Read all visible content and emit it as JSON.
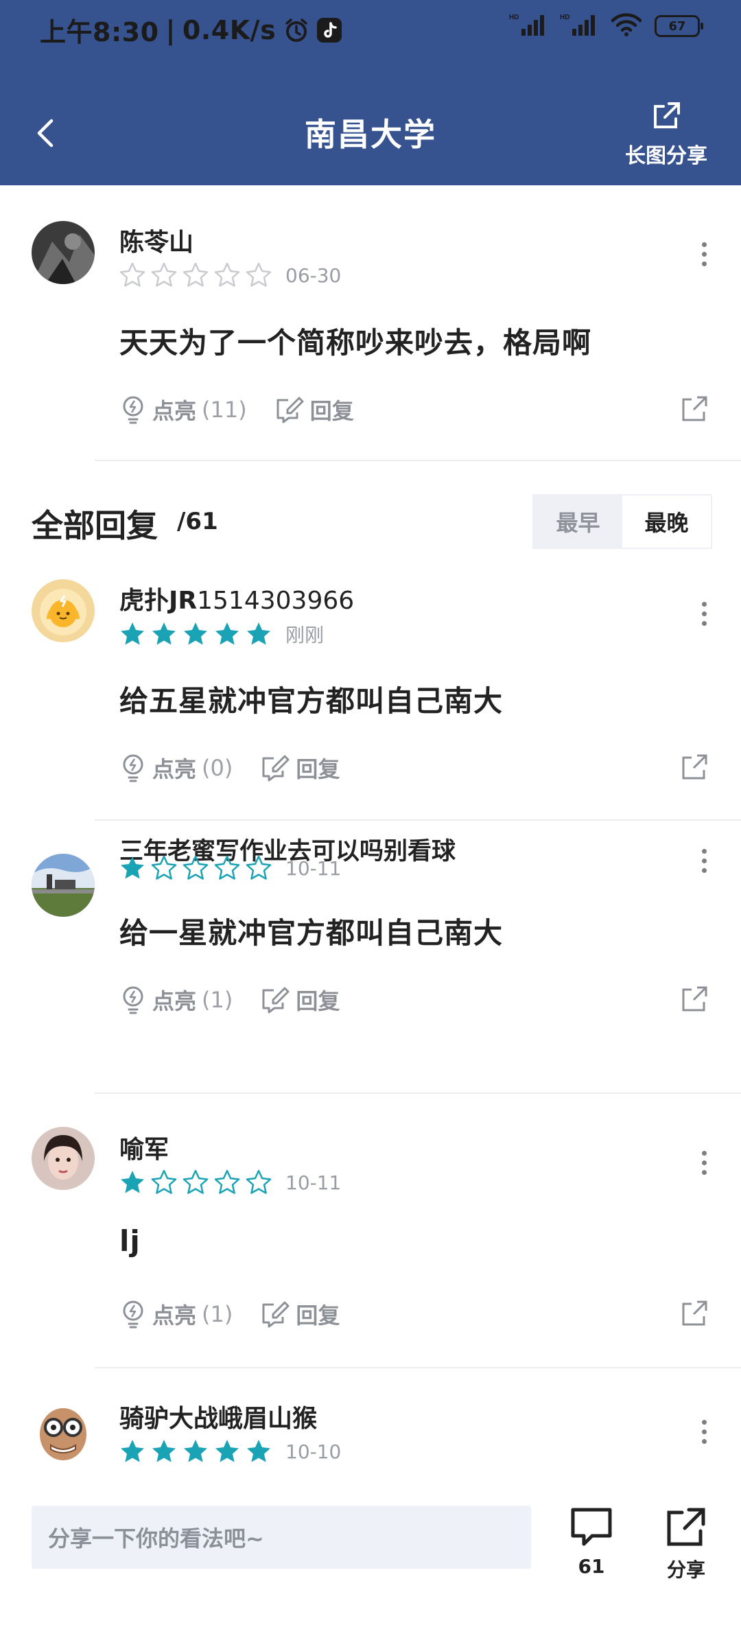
{
  "status_bar": {
    "time": "上午8:30",
    "speed": "0.4K/s",
    "battery": "67",
    "signal_label_1": "HD",
    "signal_label_2": "HD"
  },
  "header": {
    "title": "南昌大学",
    "share_long_label": "长图分享"
  },
  "main_comment": {
    "name": "陈苓山",
    "rating": 0,
    "time": "06-30",
    "text": "天天为了一个简称吵来吵去，格局啊",
    "like_label": "点亮",
    "like_count": "(11)",
    "reply_label": "回复"
  },
  "replies_section": {
    "title": "全部回复",
    "count": "/61",
    "sort_options": [
      "最早",
      "最晚"
    ],
    "sort_selected": "最晚"
  },
  "replies": [
    {
      "name": "虎扑JR",
      "name_suffix": "1514303966",
      "rating": 5,
      "time": "刚刚",
      "text": "给五星就冲官方都叫自己南大",
      "like_label": "点亮",
      "like_count": "(0)",
      "reply_label": "回复"
    },
    {
      "name": "三年老蜜写作业去可以吗别看球",
      "name_suffix": "",
      "rating": 1,
      "time": "10-11",
      "text": "给一星就冲官方都叫自己南大",
      "like_label": "点亮",
      "like_count": "(1)",
      "reply_label": "回复"
    },
    {
      "name": "喻军",
      "name_suffix": "",
      "rating": 1,
      "time": "10-11",
      "text": "lj",
      "like_label": "点亮",
      "like_count": "(1)",
      "reply_label": "回复"
    },
    {
      "name": "骑驴大战峨眉山猴",
      "name_suffix": "",
      "rating": 5,
      "time": "10-10"
    }
  ],
  "bottom_bar": {
    "input_placeholder": "分享一下你的看法吧~",
    "comment_count": "61",
    "share_label": "分享"
  },
  "colors": {
    "header_bg": "#36528f",
    "star_filled": "#1aa2b5",
    "star_empty": "#c9cbd0",
    "input_bg": "#eef1f8"
  }
}
